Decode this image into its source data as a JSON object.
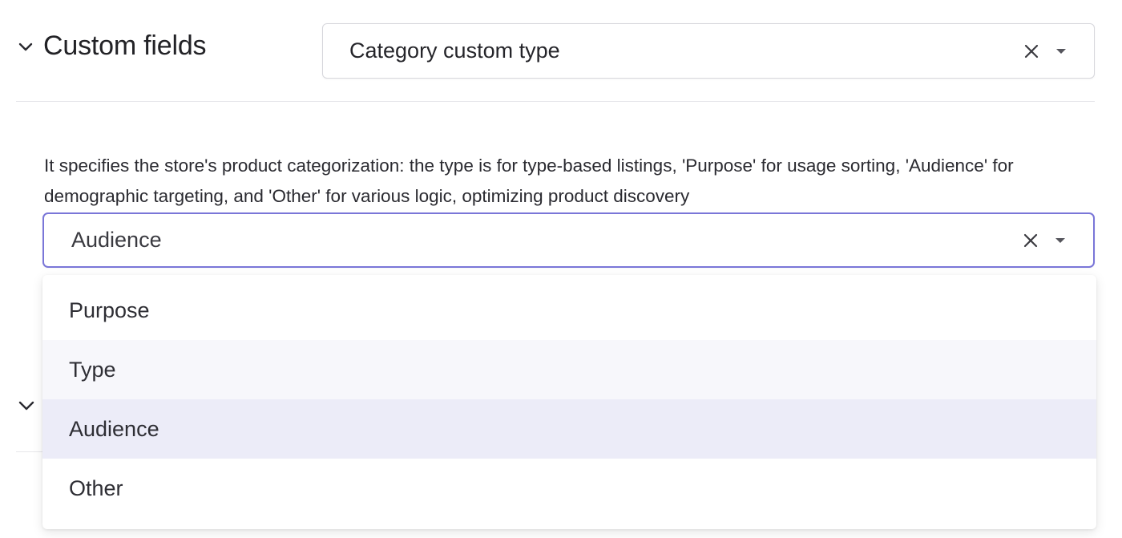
{
  "section": {
    "title": "Custom fields",
    "icon": "chevron-down-icon"
  },
  "type_select": {
    "value": "Category custom type",
    "clear_icon": "close-icon",
    "caret_icon": "caret-down-icon"
  },
  "description": "It specifies the store's product categorization: the type is for type-based listings, 'Purpose' for usage sorting, 'Audience' for demographic targeting, and 'Other' for various logic, optimizing product discovery",
  "audience_select": {
    "value": "Audience",
    "clear_icon": "close-icon",
    "caret_icon": "caret-down-icon",
    "focus_color": "#7a76d8"
  },
  "dropdown": {
    "options": [
      {
        "label": "Purpose",
        "state": "normal"
      },
      {
        "label": "Type",
        "state": "hover"
      },
      {
        "label": "Audience",
        "state": "selected"
      },
      {
        "label": "Other",
        "state": "normal"
      }
    ],
    "selected_color": "#ececf8",
    "hover_color": "#f7f7fb"
  }
}
